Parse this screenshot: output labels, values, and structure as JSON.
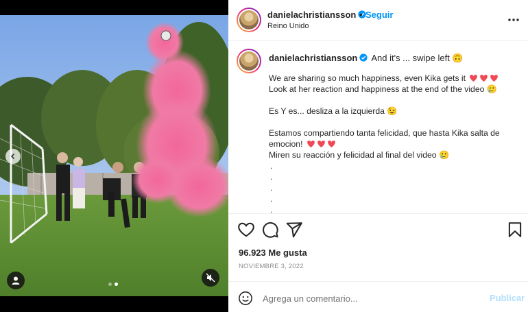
{
  "post": {
    "username": "danielachristiansson",
    "separator": "•",
    "follow_label": "Seguir",
    "location": "Reino Unido",
    "more_icon": "more-horizontal-icon"
  },
  "caption": {
    "username": "danielachristiansson",
    "title": "And it's ... swipe left 🙃",
    "lines": [
      "We are sharing so much happiness, even Kika gets it",
      "Look at her reaction and happiness at the end of the video 🥲",
      "",
      "Es Y es... desliza a la izquierda 😉",
      "",
      "Estamos compartiendo tanta felicidad, que hasta Kika salta de emocion!",
      "Miren su reacción y felicidad al final del video 🥲"
    ],
    "bullets": [
      ".",
      ".",
      ".",
      ".",
      "."
    ]
  },
  "stats": {
    "likes": "96.923 Me gusta",
    "date": "NOVIEMBRE 3, 2022"
  },
  "comment": {
    "placeholder": "Agrega un comentario...",
    "publish_label": "Publicar"
  },
  "carousel": {
    "slide_count": 2,
    "active_slide": 2
  },
  "colors": {
    "accent": "#0095f6",
    "publish_disabled": "#b2dffc",
    "heart": "#ed4956",
    "smoke_pink": "#f06b9a"
  }
}
